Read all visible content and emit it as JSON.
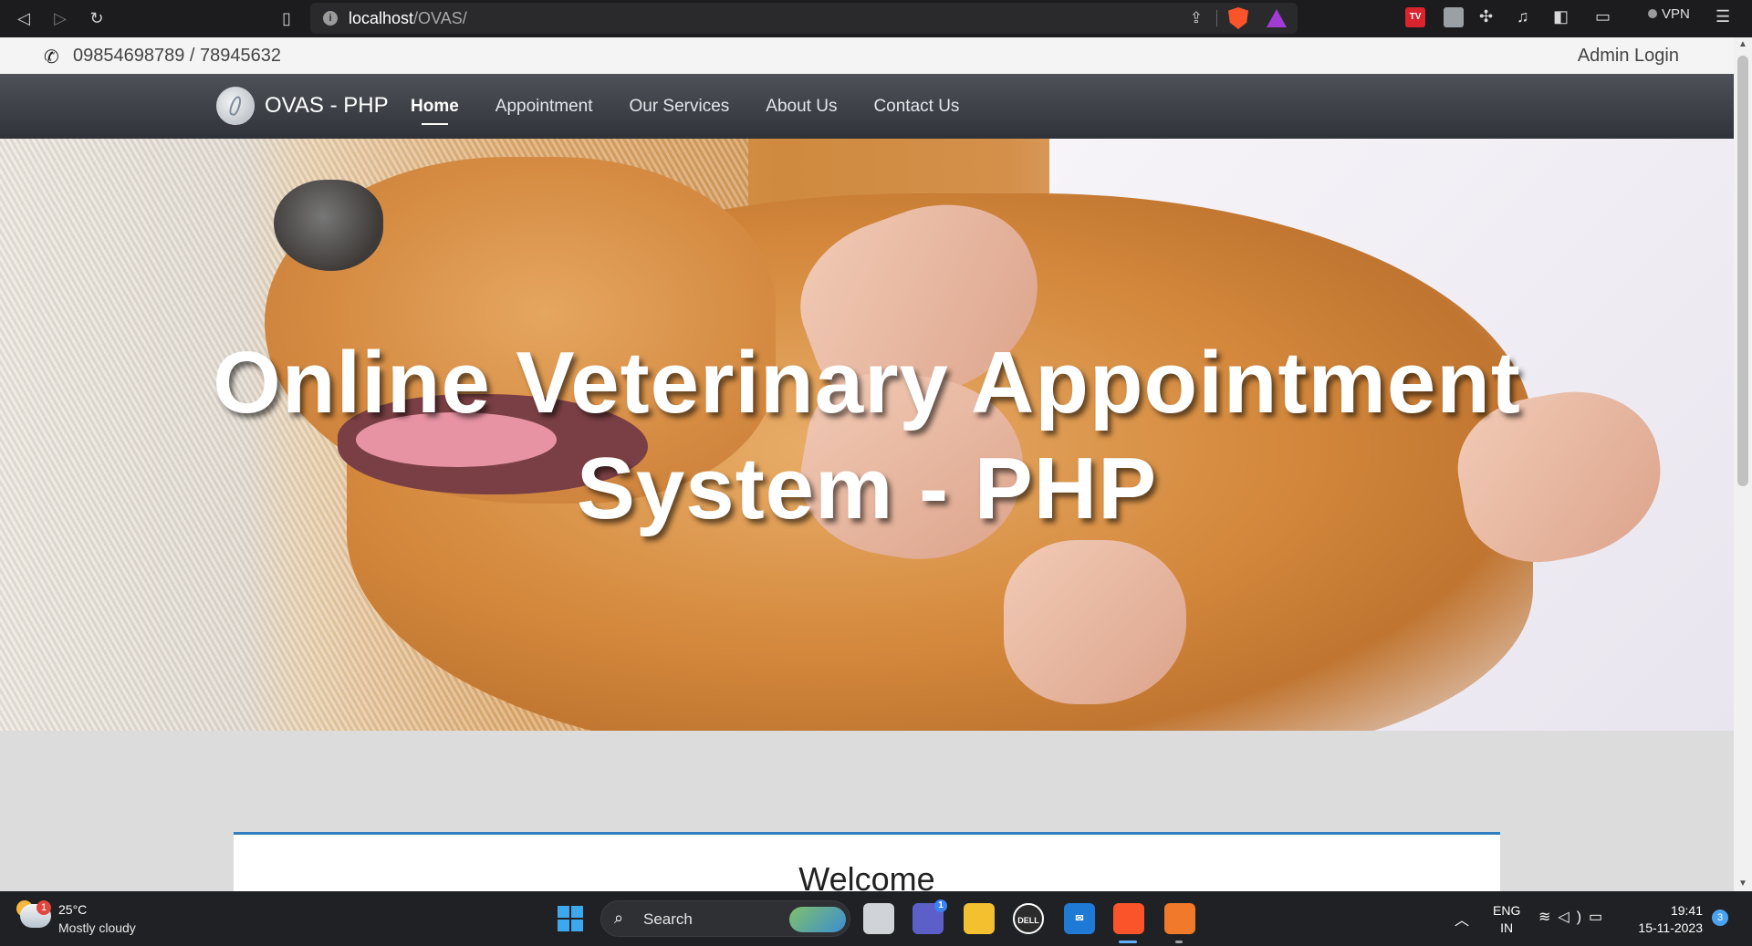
{
  "browser": {
    "url_host": "localhost",
    "url_path": "/OVAS/",
    "extension_tv_label": "TV",
    "vpn_label": "VPN"
  },
  "topbar": {
    "phone": "09854698789 / 78945632",
    "admin_login": "Admin Login"
  },
  "navbar": {
    "brand": "OVAS - PHP",
    "links": [
      {
        "label": "Home",
        "active": true
      },
      {
        "label": "Appointment",
        "active": false
      },
      {
        "label": "Our Services",
        "active": false
      },
      {
        "label": "About Us",
        "active": false
      },
      {
        "label": "Contact Us",
        "active": false
      }
    ]
  },
  "hero": {
    "title_line1": "Online Veterinary Appointment",
    "title_line2": "System - PHP"
  },
  "content": {
    "welcome_title": "Welcome",
    "accent_color": "#2f7fc1"
  },
  "taskbar": {
    "weather_badge": "1",
    "weather_temp": "25°C",
    "weather_desc": "Mostly cloudy",
    "search_label": "Search",
    "teams_badge": "1",
    "lang_line1": "ENG",
    "lang_line2": "IN",
    "time": "19:41",
    "date": "15-11-2023",
    "notification_count": "3"
  }
}
